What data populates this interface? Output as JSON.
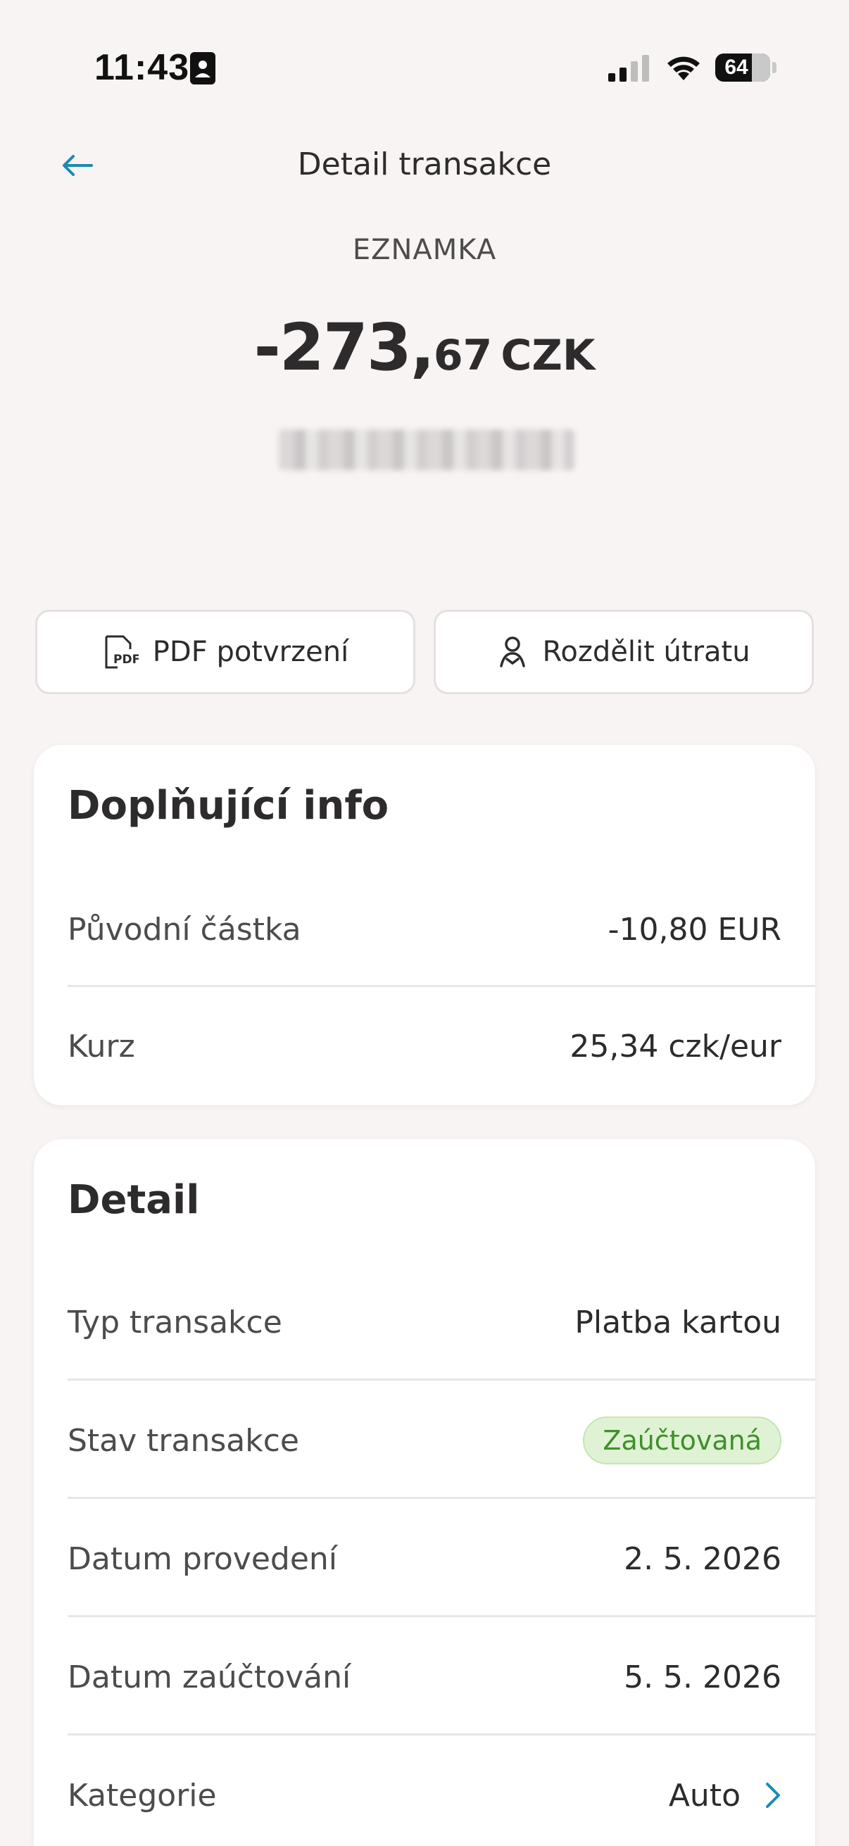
{
  "status_bar": {
    "time": "11:43",
    "battery": "64"
  },
  "nav": {
    "title": "Detail transakce"
  },
  "transaction": {
    "merchant": "EZNAMKA",
    "amount_major": "-273,",
    "amount_minor": "67",
    "currency": "CZK"
  },
  "actions": {
    "pdf_label": "PDF potvrzení",
    "split_label": "Rozdělit útratu"
  },
  "info": {
    "title": "Doplňující info",
    "rows": [
      {
        "label": "Původní částka",
        "value": "-10,80 EUR"
      },
      {
        "label": "Kurz",
        "value": "25,34 czk/eur"
      }
    ]
  },
  "detail": {
    "title": "Detail",
    "rows": [
      {
        "label": "Typ transakce",
        "value": "Platba kartou"
      },
      {
        "label": "Stav transakce",
        "value": "Zaúčtovaná"
      },
      {
        "label": "Datum provedení",
        "value": "2. 5. 2026"
      },
      {
        "label": "Datum zaúčtování",
        "value": "5. 5. 2026"
      },
      {
        "label": "Kategorie",
        "value": "Auto"
      }
    ]
  },
  "colors": {
    "accent": "#1a8bb0",
    "status_green": "#3f8f2a",
    "background": "#f7f4f3"
  }
}
